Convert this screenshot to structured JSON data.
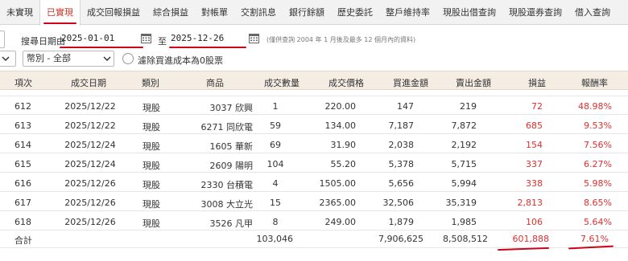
{
  "tabs": [
    {
      "label": "未實現",
      "active": false
    },
    {
      "label": "已實現",
      "active": true
    },
    {
      "label": "成交回報損益",
      "active": false
    },
    {
      "label": "綜合損益",
      "active": false
    },
    {
      "label": "對帳單",
      "active": false
    },
    {
      "label": "交割訊息",
      "active": false
    },
    {
      "label": "銀行餘額",
      "active": false
    },
    {
      "label": "歷史委託",
      "active": false
    },
    {
      "label": "整戶維持率",
      "active": false
    },
    {
      "label": "現股出借查詢",
      "active": false
    },
    {
      "label": "現股還券查詢",
      "active": false
    },
    {
      "label": "借入查詢",
      "active": false
    }
  ],
  "filter": {
    "date_label": "搜尋日期由",
    "start_date": "2025-01-01",
    "to_label": "至",
    "end_date": "2025-12-26",
    "note": "(僅供查詢 2004 年 1 月後及最多 12 個月內的資料)",
    "category_select": "幣別 - 全部",
    "exclude_label": "濾除買進成本為0股票"
  },
  "table": {
    "headers": [
      "項次",
      "成交日期",
      "類別",
      "商品",
      "成交數量",
      "成交價格",
      "買進金額",
      "賣出金額",
      "損益",
      "報酬率"
    ],
    "rows": [
      {
        "no": "612",
        "date": "2025/12/22",
        "type": "現股",
        "product": "3037 欣興",
        "qty": "1",
        "price": "220.00",
        "buy": "147",
        "sell": "219",
        "pl": "72",
        "ret": "48.98%"
      },
      {
        "no": "613",
        "date": "2025/12/22",
        "type": "現股",
        "product": "6271 同欣電",
        "qty": "59",
        "price": "134.00",
        "buy": "7,187",
        "sell": "7,872",
        "pl": "685",
        "ret": "9.53%"
      },
      {
        "no": "614",
        "date": "2025/12/24",
        "type": "現股",
        "product": "1605 華新",
        "qty": "69",
        "price": "31.90",
        "buy": "2,038",
        "sell": "2,192",
        "pl": "154",
        "ret": "7.56%"
      },
      {
        "no": "615",
        "date": "2025/12/24",
        "type": "現股",
        "product": "2609 陽明",
        "qty": "104",
        "price": "55.20",
        "buy": "5,378",
        "sell": "5,715",
        "pl": "337",
        "ret": "6.27%"
      },
      {
        "no": "616",
        "date": "2025/12/26",
        "type": "現股",
        "product": "2330 台積電",
        "qty": "4",
        "price": "1505.00",
        "buy": "5,656",
        "sell": "5,994",
        "pl": "338",
        "ret": "5.98%"
      },
      {
        "no": "617",
        "date": "2025/12/26",
        "type": "現股",
        "product": "3008 大立光",
        "qty": "15",
        "price": "2365.00",
        "buy": "32,506",
        "sell": "35,319",
        "pl": "2,813",
        "ret": "8.65%"
      },
      {
        "no": "618",
        "date": "2025/12/26",
        "type": "現股",
        "product": "3526 凡甲",
        "qty": "8",
        "price": "249.00",
        "buy": "1,879",
        "sell": "1,985",
        "pl": "106",
        "ret": "5.64%"
      }
    ],
    "total": {
      "label": "合計",
      "qty": "103,046",
      "buy": "7,906,625",
      "sell": "8,508,512",
      "pl": "601,888",
      "ret": "7.61%"
    }
  },
  "colors": {
    "accent_red": "#d0021b",
    "profit_red": "#e03030",
    "header_bg": "#f5ede4"
  }
}
